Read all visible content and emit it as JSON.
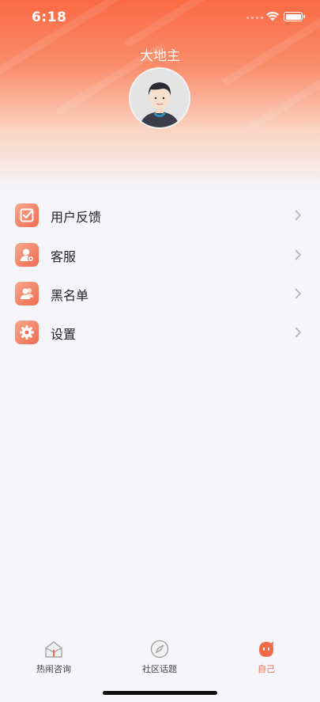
{
  "status_bar": {
    "time": "6:18"
  },
  "profile": {
    "username": "大地主"
  },
  "menu": {
    "items": [
      {
        "label": "用户反馈",
        "icon": "feedback-check-icon"
      },
      {
        "label": "客服",
        "icon": "customer-service-icon"
      },
      {
        "label": "黑名单",
        "icon": "blacklist-users-icon"
      },
      {
        "label": "设置",
        "icon": "settings-gear-icon"
      }
    ]
  },
  "tabbar": {
    "tabs": [
      {
        "label": "热闹咨询",
        "icon": "home-icon",
        "active": false
      },
      {
        "label": "社区话题",
        "icon": "compass-icon",
        "active": false
      },
      {
        "label": "自己",
        "icon": "mascot-face-icon",
        "active": true
      }
    ]
  },
  "colors": {
    "accent": "#f26b47",
    "header_top": "#fa6a44",
    "background": "#f5f5fa"
  }
}
